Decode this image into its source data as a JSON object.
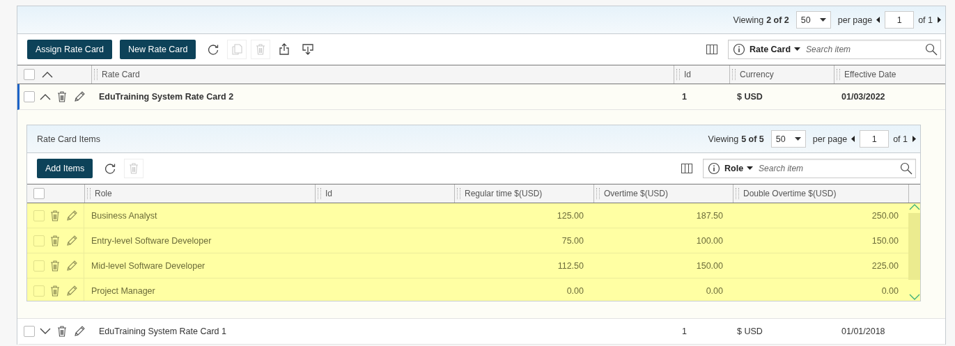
{
  "grid": {
    "pager": {
      "viewing_label": "Viewing",
      "count": "2 of 2",
      "per_page": "50",
      "per_page_label": "per page",
      "page": "1",
      "of_pages": "of 1"
    },
    "toolbar": {
      "buttons": [
        "Assign Rate Card",
        "New Rate Card"
      ],
      "icons": [
        {
          "kind": "refresh",
          "disabled": false
        },
        {
          "kind": "copy",
          "disabled": true
        },
        {
          "kind": "delete",
          "disabled": true
        },
        {
          "kind": "export",
          "disabled": false
        },
        {
          "kind": "import",
          "disabled": false
        }
      ]
    },
    "search": {
      "field": "Rate Card",
      "placeholder": "Search item"
    },
    "columns": [
      "Rate Card",
      "Id",
      "Currency",
      "Effective Date"
    ],
    "select_all_checked": false,
    "rows": [
      {
        "name": "EduTraining System Rate Card 2",
        "id": "1",
        "currency": "$ USD",
        "effective_date": "01/03/2022",
        "selected": true,
        "checked": false,
        "expanded": true,
        "items": {
          "title": "Rate Card Items",
          "pager": {
            "viewing_label": "Viewing",
            "count": "5 of 5",
            "per_page": "50",
            "per_page_label": "per page",
            "page": "1",
            "of_pages": "of 1"
          },
          "toolbar": {
            "buttons": [
              "Add Items"
            ],
            "icons": [
              {
                "kind": "refresh",
                "disabled": false
              },
              {
                "kind": "delete",
                "disabled": true
              }
            ]
          },
          "search": {
            "field": "Role",
            "placeholder": "Search item"
          },
          "columns": [
            "Role",
            "Id",
            "Regular time $(USD)",
            "Overtime $(USD)",
            "Double Overtime $(USD)"
          ],
          "select_all_checked": false,
          "rows": [
            {
              "role": "Business Analyst",
              "regular": "125.00",
              "overtime": "187.50",
              "double_overtime": "250.00",
              "highlighted": true,
              "checked": false
            },
            {
              "role": "Entry-level Software Developer",
              "regular": "75.00",
              "overtime": "100.00",
              "double_overtime": "150.00",
              "highlighted": true,
              "checked": false
            },
            {
              "role": "Mid-level Software Developer",
              "regular": "112.50",
              "overtime": "150.00",
              "double_overtime": "225.00",
              "highlighted": true,
              "checked": false
            },
            {
              "role": "Project Manager",
              "regular": "0.00",
              "overtime": "0.00",
              "double_overtime": "0.00",
              "highlighted": true,
              "checked": false
            }
          ]
        }
      },
      {
        "name": "EduTraining System Rate Card 1",
        "id": "1",
        "currency": "$ USD",
        "effective_date": "01/01/2018",
        "selected": false,
        "checked": false,
        "expanded": false
      }
    ]
  }
}
